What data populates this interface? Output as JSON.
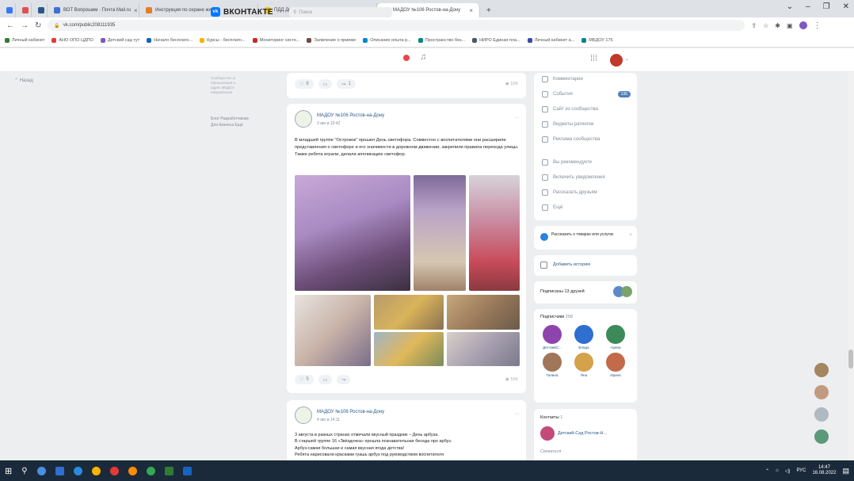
{
  "browser": {
    "tabs": [
      {
        "title": "ВОТ Вопрошим · Почта Mail.ru",
        "color": "#3c6fd8",
        "active": false
      },
      {
        "title": "Инструкция по охране жизни",
        "color": "#e67e22",
        "active": false
      },
      {
        "title": "ПДД Детям",
        "color": "#f1c40f",
        "active": false
      },
      {
        "title": "МАДОУ №106 Ростов-на-Дону",
        "color": "#0077ff",
        "active": true
      }
    ],
    "new_tab": "+",
    "url": "vk.com/public208111935",
    "bookmarks": [
      "Личный кабинет",
      "АНО ОПО ЦДПО",
      "Детский сад тут",
      "Начало бесплатн...",
      "Курсы - бесплатн...",
      "Мониторинг систе...",
      "Заявление о приеме",
      "Описание опыта р...",
      "Пространство без...",
      "НИРО Единая пла...",
      "Личный кабинет а...",
      "МБДОУ 175"
    ]
  },
  "vk": {
    "logo": "ВКОНТАКТЕ",
    "search_placeholder": "Поиск",
    "back_link": "Назад",
    "left_footer": "Блог  Разработчикам\nДля бизнеса  Ещё",
    "left_note": "Сообщество от\nОрганизация в...\nадрес МБДОУ\nнаправления"
  },
  "posts": [
    {
      "likes": "8",
      "views": "10K"
    },
    {
      "author": "МАДОУ №106 Ростов-на-Дону",
      "date": "3 авг в 10:42",
      "text": "В младшей группе \"Островок\" прошел День светофора. Совместно с воспитателями они расширили представления о светофоре и его значимости в дорожном движении, закрепили правила перехода улицы. Также ребята играли, делали аппликацию светофор.",
      "likes": "5",
      "views": "10K"
    },
    {
      "author": "МАДОУ №106 Ростов-на-Дону",
      "date": "4 авг в 14:11",
      "text": "3 августа в разных странах отмечали вкусный праздник – День арбуза.\nВ старшей группе 16 «Звёздочка» прошла познавательная беседа про арбуз.\nАрбуз-самая большая и самая вкусная ягода детства!\nРебята нарисовали красками гуашь арбуз под руководством воспитателя"
    }
  ],
  "right_menu": [
    {
      "label": "Комментарии",
      "badge": ""
    },
    {
      "label": "События",
      "badge": "136"
    },
    {
      "label": "Сайт из сообщества",
      "badge": ""
    },
    {
      "label": "Виджеты ратингов",
      "badge": ""
    },
    {
      "label": "Реклама сообщества",
      "badge": ""
    },
    {
      "label": "Вы рекомендуете",
      "badge": ""
    },
    {
      "label": "Включить уведомления",
      "badge": ""
    },
    {
      "label": "Рассказать друзьям",
      "badge": ""
    },
    {
      "label": "Ещё",
      "badge": ""
    }
  ],
  "right_widgets": {
    "market_text": "Рассказать о товарах или услугах",
    "add_story": "Добавить историю",
    "subscriptions": "Подписаны 13 друзей",
    "subscribers_title": "Подписчики",
    "subscribers_count": "258",
    "subscribers": [
      "ДетскийС...",
      "Влада",
      "Арина",
      "Галина",
      "Яна",
      "Ирина"
    ],
    "contacts_title": "Контакты",
    "contacts_count": "1",
    "contact_name": "Детский-Сад Ростов-Н...",
    "contacts_more": "Связаться"
  },
  "taskbar": {
    "lang": "РУС",
    "time": "14:47",
    "date": "16.08.2022"
  }
}
